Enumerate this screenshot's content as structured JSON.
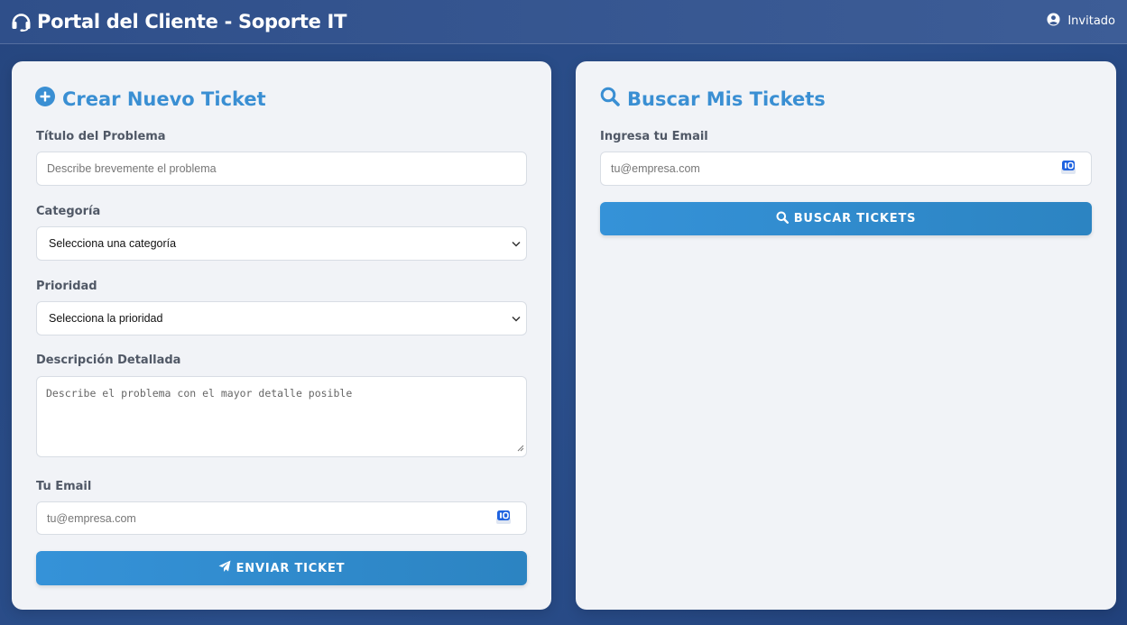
{
  "header": {
    "title": "Portal del Cliente - Soporte IT",
    "user_label": "Invitado",
    "brand_icon": "headset-icon",
    "user_icon": "user-circle-icon"
  },
  "create_ticket": {
    "title": "Crear Nuevo Ticket",
    "title_icon": "plus-circle-icon",
    "problem_title_label": "Título del Problema",
    "problem_title_placeholder": "Describe brevemente el problema",
    "category_label": "Categoría",
    "category_selected": "Selecciona una categoría",
    "priority_label": "Prioridad",
    "priority_selected": "Selecciona la prioridad",
    "description_label": "Descripción Detallada",
    "description_placeholder": "Describe el problema con el mayor detalle posible",
    "email_label": "Tu Email",
    "email_placeholder": "tu@empresa.com",
    "submit_label": "ENVIAR TICKET",
    "submit_icon": "paper-plane-icon"
  },
  "search_tickets": {
    "title": "Buscar Mis Tickets",
    "title_icon": "search-icon",
    "email_label": "Ingresa tu Email",
    "email_placeholder": "tu@empresa.com",
    "button_label": "BUSCAR TICKETS",
    "button_icon": "search-icon"
  },
  "colors": {
    "accent": "#3a8fd3",
    "button": "#3592d8",
    "background": "#26467f",
    "card": "#f1f3f7"
  }
}
